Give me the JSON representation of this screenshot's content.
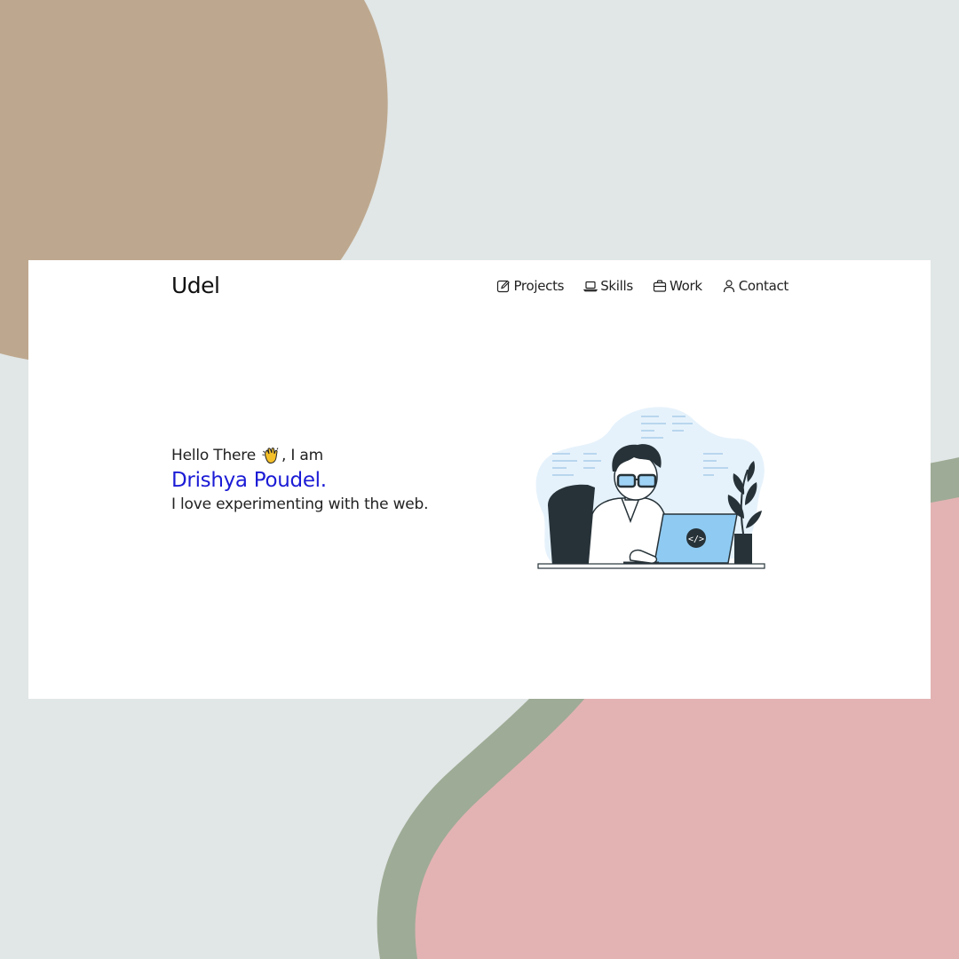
{
  "colors": {
    "background": "#e1e6e6",
    "tan_blob": "#bda88f",
    "sage_band": "#9eab96",
    "pink_blob": "#e3b3b3",
    "window": "#ffffff",
    "accent": "#1b1bd6",
    "text": "#222222"
  },
  "header": {
    "logo": "Udel",
    "nav": [
      {
        "label": "Projects",
        "icon": "edit-icon"
      },
      {
        "label": "Skills",
        "icon": "laptop-icon"
      },
      {
        "label": "Work",
        "icon": "briefcase-icon"
      },
      {
        "label": "Contact",
        "icon": "user-icon"
      }
    ]
  },
  "hero": {
    "greeting_before": "Hello There",
    "greeting_after": ", I am",
    "wave_icon": "waving-hand-icon",
    "name": "Drishya Poudel.",
    "tagline": "I love experimenting with the web.",
    "illustration": "developer-at-laptop-illustration"
  }
}
